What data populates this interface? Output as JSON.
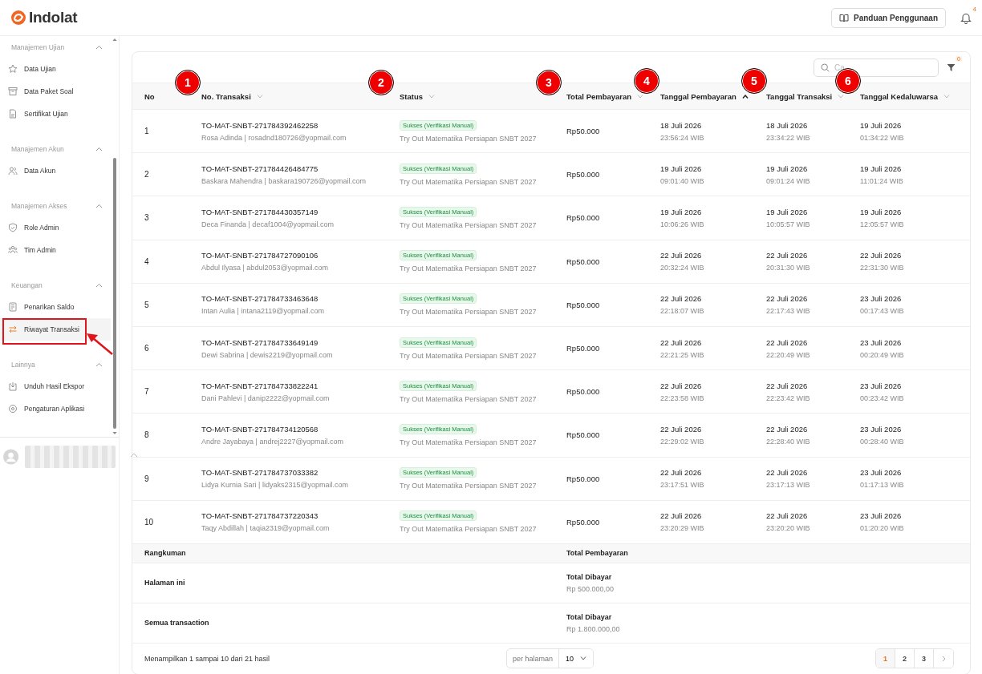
{
  "header": {
    "brand": "Indolat",
    "guide_button": "Panduan Penggunaan",
    "notification_count": "4"
  },
  "sidebar": {
    "sections": [
      {
        "title": "Manajemen Ujian",
        "expanded": true,
        "items": [
          {
            "label": "Data Ujian",
            "selected": false
          },
          {
            "label": "Data Paket Soal",
            "selected": false
          },
          {
            "label": "Sertifikat Ujian",
            "selected": false
          }
        ]
      },
      {
        "title": "Manajemen Akun",
        "expanded": true,
        "items": [
          {
            "label": "Data Akun",
            "selected": false
          }
        ]
      },
      {
        "title": "Manajemen Akses",
        "expanded": true,
        "items": [
          {
            "label": "Role Admin",
            "selected": false
          },
          {
            "label": "Tim Admin",
            "selected": false
          }
        ]
      },
      {
        "title": "Keuangan",
        "expanded": true,
        "items": [
          {
            "label": "Penarikan Saldo",
            "selected": false
          },
          {
            "label": "Riwayat Transaksi",
            "selected": true
          }
        ]
      },
      {
        "title": "Lainnya",
        "expanded": true,
        "items": [
          {
            "label": "Unduh Hasil Ekspor",
            "selected": false
          },
          {
            "label": "Pengaturan Aplikasi",
            "selected": false
          }
        ]
      }
    ]
  },
  "toolbar": {
    "search": {
      "placeholder": "Ca"
    },
    "filter_count": "0"
  },
  "table": {
    "columns": [
      {
        "label": "No"
      },
      {
        "label": "No. Transaksi",
        "sorted": false
      },
      {
        "label": "Status",
        "sorted": false
      },
      {
        "label": "Total Pembayaran",
        "sorted": false
      },
      {
        "label": "Tanggal Pembayaran",
        "sorted": true
      },
      {
        "label": "Tanggal Transaksi",
        "sorted": false
      },
      {
        "label": "Tanggal Kedaluwarsa",
        "sorted": false
      }
    ],
    "rows": [
      {
        "no": "1",
        "transaction": "TO-MAT-SNBT-271784392462258",
        "customer": "Rosa Adinda | rosadnd180726@yopmail.com",
        "status": "Sukses (Verifikasi Manual)",
        "product": "Try Out Matematika Persiapan SNBT 2027",
        "amount": "Rp50.000",
        "paid": {
          "date": "18 Juli 2026",
          "time": "23:56:24 WIB"
        },
        "created": {
          "date": "18 Juli 2026",
          "time": "23:34:22 WIB"
        },
        "expires": {
          "date": "19 Juli 2026",
          "time": "01:34:22 WIB"
        }
      },
      {
        "no": "2",
        "transaction": "TO-MAT-SNBT-271784426484775",
        "customer": "Baskara Mahendra | baskara190726@yopmail.com",
        "status": "Sukses (Verifikasi Manual)",
        "product": "Try Out Matematika Persiapan SNBT 2027",
        "amount": "Rp50.000",
        "paid": {
          "date": "19 Juli 2026",
          "time": "09:01:40 WIB"
        },
        "created": {
          "date": "19 Juli 2026",
          "time": "09:01:24 WIB"
        },
        "expires": {
          "date": "19 Juli 2026",
          "time": "11:01:24 WIB"
        }
      },
      {
        "no": "3",
        "transaction": "TO-MAT-SNBT-271784430357149",
        "customer": "Deca Finanda | decaf1004@yopmail.com",
        "status": "Sukses (Verifikasi Manual)",
        "product": "Try Out Matematika Persiapan SNBT 2027",
        "amount": "Rp50.000",
        "paid": {
          "date": "19 Juli 2026",
          "time": "10:06:26 WIB"
        },
        "created": {
          "date": "19 Juli 2026",
          "time": "10:05:57 WIB"
        },
        "expires": {
          "date": "19 Juli 2026",
          "time": "12:05:57 WIB"
        }
      },
      {
        "no": "4",
        "transaction": "TO-MAT-SNBT-271784727090106",
        "customer": "Abdul Ilyasa | abdul2053@yopmail.com",
        "status": "Sukses (Verifikasi Manual)",
        "product": "Try Out Matematika Persiapan SNBT 2027",
        "amount": "Rp50.000",
        "paid": {
          "date": "22 Juli 2026",
          "time": "20:32:24 WIB"
        },
        "created": {
          "date": "22 Juli 2026",
          "time": "20:31:30 WIB"
        },
        "expires": {
          "date": "22 Juli 2026",
          "time": "22:31:30 WIB"
        }
      },
      {
        "no": "5",
        "transaction": "TO-MAT-SNBT-271784733463648",
        "customer": "Intan Aulia | intana2119@yopmail.com",
        "status": "Sukses (Verifikasi Manual)",
        "product": "Try Out Matematika Persiapan SNBT 2027",
        "amount": "Rp50.000",
        "paid": {
          "date": "22 Juli 2026",
          "time": "22:18:07 WIB"
        },
        "created": {
          "date": "22 Juli 2026",
          "time": "22:17:43 WIB"
        },
        "expires": {
          "date": "23 Juli 2026",
          "time": "00:17:43 WIB"
        }
      },
      {
        "no": "6",
        "transaction": "TO-MAT-SNBT-271784733649149",
        "customer": "Dewi Sabrina | dewis2219@yopmail.com",
        "status": "Sukses (Verifikasi Manual)",
        "product": "Try Out Matematika Persiapan SNBT 2027",
        "amount": "Rp50.000",
        "paid": {
          "date": "22 Juli 2026",
          "time": "22:21:25 WIB"
        },
        "created": {
          "date": "22 Juli 2026",
          "time": "22:20:49 WIB"
        },
        "expires": {
          "date": "23 Juli 2026",
          "time": "00:20:49 WIB"
        }
      },
      {
        "no": "7",
        "transaction": "TO-MAT-SNBT-271784733822241",
        "customer": "Dani Pahlevi | danip2222@yopmail.com",
        "status": "Sukses (Verifikasi Manual)",
        "product": "Try Out Matematika Persiapan SNBT 2027",
        "amount": "Rp50.000",
        "paid": {
          "date": "22 Juli 2026",
          "time": "22:23:58 WIB"
        },
        "created": {
          "date": "22 Juli 2026",
          "time": "22:23:42 WIB"
        },
        "expires": {
          "date": "23 Juli 2026",
          "time": "00:23:42 WIB"
        }
      },
      {
        "no": "8",
        "transaction": "TO-MAT-SNBT-271784734120568",
        "customer": "Andre Jayabaya | andrej2227@yopmail.com",
        "status": "Sukses (Verifikasi Manual)",
        "product": "Try Out Matematika Persiapan SNBT 2027",
        "amount": "Rp50.000",
        "paid": {
          "date": "22 Juli 2026",
          "time": "22:29:02 WIB"
        },
        "created": {
          "date": "22 Juli 2026",
          "time": "22:28:40 WIB"
        },
        "expires": {
          "date": "23 Juli 2026",
          "time": "00:28:40 WIB"
        }
      },
      {
        "no": "9",
        "transaction": "TO-MAT-SNBT-271784737033382",
        "customer": "Lidya Kurnia Sari | lidyaks2315@yopmail.com",
        "status": "Sukses (Verifikasi Manual)",
        "product": "Try Out Matematika Persiapan SNBT 2027",
        "amount": "Rp50.000",
        "paid": {
          "date": "22 Juli 2026",
          "time": "23:17:51 WIB"
        },
        "created": {
          "date": "22 Juli 2026",
          "time": "23:17:13 WIB"
        },
        "expires": {
          "date": "23 Juli 2026",
          "time": "01:17:13 WIB"
        }
      },
      {
        "no": "10",
        "transaction": "TO-MAT-SNBT-271784737220343",
        "customer": "Taqy Abdillah | taqia2319@yopmail.com",
        "status": "Sukses (Verifikasi Manual)",
        "product": "Try Out Matematika Persiapan SNBT 2027",
        "amount": "Rp50.000",
        "paid": {
          "date": "22 Juli 2026",
          "time": "23:20:29 WIB"
        },
        "created": {
          "date": "22 Juli 2026",
          "time": "23:20:20 WIB"
        },
        "expires": {
          "date": "23 Juli 2026",
          "time": "01:20:20 WIB"
        }
      }
    ]
  },
  "summary": {
    "title": "Rangkuman",
    "value_heading": "Total Pembayaran",
    "rows": [
      {
        "label": "Halaman ini",
        "value_label": "Total Dibayar",
        "value": "Rp 500.000,00"
      },
      {
        "label": "Semua transaction",
        "value_label": "Total Dibayar",
        "value": "Rp 1.800.000,00"
      }
    ]
  },
  "footer": {
    "range_text": "Menampilkan 1 sampai 10 dari 21 hasil",
    "per_page_label": "per halaman",
    "per_page_value": "10",
    "pages": [
      {
        "label": "1",
        "selected": true
      },
      {
        "label": "2",
        "selected": false
      },
      {
        "label": "3",
        "selected": false
      }
    ]
  },
  "annotations": {
    "markers": [
      "1",
      "2",
      "3",
      "4",
      "5",
      "6"
    ]
  }
}
